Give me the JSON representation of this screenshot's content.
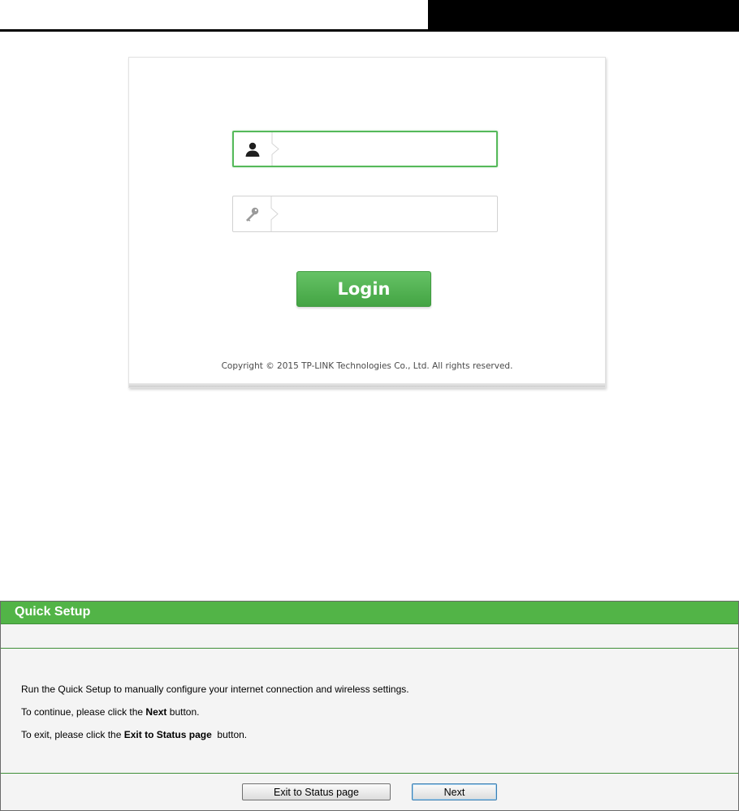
{
  "login": {
    "username_icon": "user-icon",
    "password_icon": "key-icon",
    "username_value": "",
    "password_value": "",
    "login_label": "Login",
    "copyright": "Copyright © 2015 TP-LINK Technologies Co., Ltd. All rights reserved.",
    "colors": {
      "accent": "#55b95a",
      "button": "#4aa84a"
    }
  },
  "quick_setup": {
    "title": "Quick Setup",
    "intro": "Run the Quick Setup to manually configure your internet connection and wireless settings.",
    "continue_prefix": "To continue, please click the ",
    "continue_bold": "Next",
    "continue_suffix": " button.",
    "exit_prefix": "To exit, please click the ",
    "exit_bold": "Exit to Status page",
    "exit_suffix": "  button.",
    "exit_button_label": "Exit to Status page",
    "next_button_label": "Next",
    "colors": {
      "header": "#52b447"
    }
  }
}
